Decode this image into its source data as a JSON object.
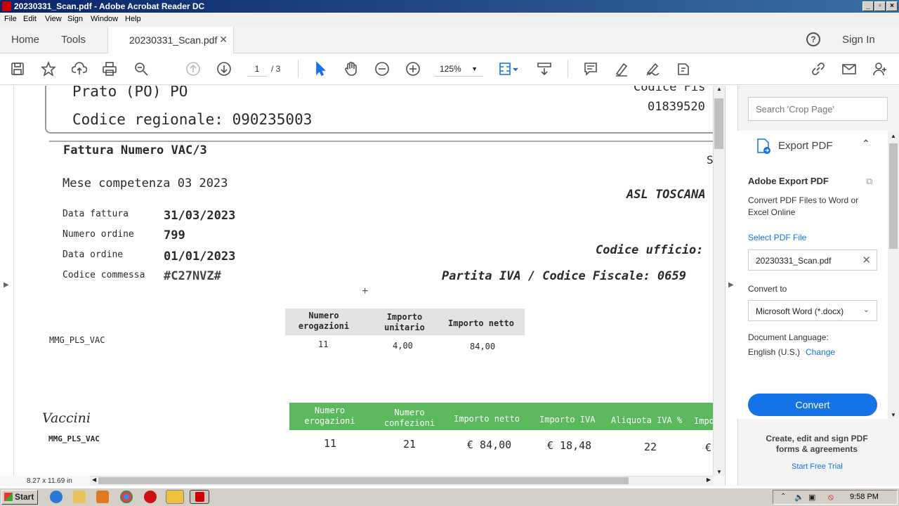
{
  "window": {
    "title": "20230331_Scan.pdf - Adobe Acrobat Reader DC"
  },
  "menu": [
    "File",
    "Edit",
    "View",
    "Sign",
    "Window",
    "Help"
  ],
  "tabs": {
    "home": "Home",
    "tools": "Tools",
    "document": "20230331_Scan.pdf",
    "help_icon": "?",
    "sign_in": "Sign In"
  },
  "toolbar": {
    "page_current": "1",
    "page_total": "/ 3",
    "zoom": "125%"
  },
  "document": {
    "address_city": "Prato (PO) PO",
    "regional_code": "Codice regionale: 090235003",
    "codice_fis_partial": "Codice Fis",
    "codice_fis_number": "01839520",
    "s_partial": "S",
    "invoice_title": "Fattura Numero VAC/3",
    "competence": "Mese competenza  03 2023",
    "asl": "ASL TOSCANA",
    "fields": [
      {
        "label": "Data fattura",
        "value": "31/03/2023"
      },
      {
        "label": "Numero ordine",
        "value": "799"
      },
      {
        "label": "Data ordine",
        "value": "01/01/2023"
      },
      {
        "label": "Codice commessa",
        "value": "#C27NVZ#"
      }
    ],
    "codice_ufficio": "Codice ufficio:",
    "partita_iva": "Partita IVA / Codice Fiscale: 0659",
    "table1": {
      "headers": [
        "Numero\nerogazioni",
        "Importo\nunitario",
        "Importo netto"
      ],
      "row_label": "MMG_PLS_VAC",
      "values": [
        "11",
        "4,00",
        "84,00"
      ]
    },
    "table2": {
      "title": "Vaccini",
      "headers": [
        "Numero\nerogazioni",
        "Numero\nconfezioni",
        "Importo netto",
        "Importo IVA",
        "Aliquota IVA %",
        "Impo"
      ],
      "row_label": "MMG_PLS_VAC",
      "values": [
        "11",
        "21",
        "€ 84,00",
        "€ 18,48",
        "22",
        "€"
      ]
    },
    "page_size": "8.27 x 11.69 in"
  },
  "right_pane": {
    "search_placeholder": "Search 'Crop Page'",
    "export_header": "Export PDF",
    "card_title": "Adobe Export PDF",
    "card_desc": "Convert PDF Files to Word or Excel Online",
    "select_file_link": "Select PDF File",
    "file_name": "20230331_Scan.pdf",
    "convert_to_label": "Convert to",
    "convert_to_value": "Microsoft Word (*.docx)",
    "doc_lang_label": "Document Language:",
    "doc_lang_value": "English (U.S.)",
    "change_link": "Change",
    "convert_button": "Convert",
    "promo_text": "Create, edit and sign PDF forms & agreements",
    "free_trial": "Start Free Trial"
  },
  "taskbar": {
    "start": "Start",
    "clock": "9:58 PM"
  },
  "colors": {
    "accent_blue": "#1473e6",
    "green_header": "#5cb85c"
  }
}
